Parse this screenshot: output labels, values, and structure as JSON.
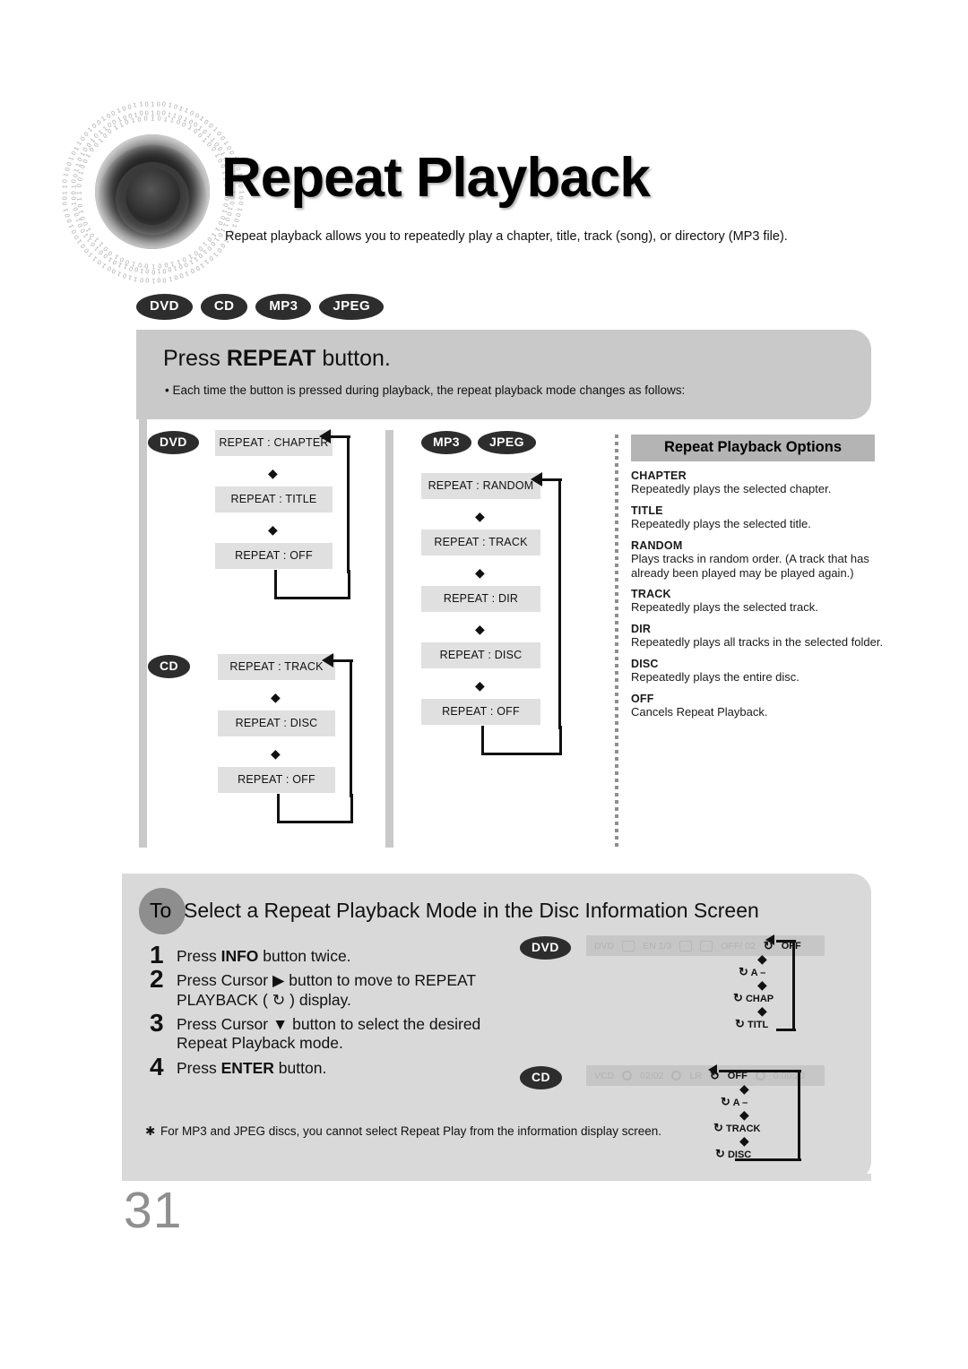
{
  "header": {
    "title": "Repeat Playback",
    "intro": "Repeat playback allows you to repeatedly play a chapter, title, track (song), or directory (MP3 file).",
    "disc_badges": [
      "DVD",
      "CD",
      "MP3",
      "JPEG"
    ]
  },
  "press_panel": {
    "title_pre": "Press ",
    "title_bold": "REPEAT",
    "title_post": " button.",
    "bullet": "• Each time the button is pressed during playback, the repeat playback mode changes as follows:"
  },
  "flows": [
    {
      "badge": "DVD",
      "steps": [
        "REPEAT : CHAPTER",
        "REPEAT : TITLE",
        "REPEAT : OFF"
      ]
    },
    {
      "badge": "CD",
      "steps": [
        "REPEAT : TRACK",
        "REPEAT : DISC",
        "REPEAT : OFF"
      ]
    },
    {
      "badges": [
        "MP3",
        "JPEG"
      ],
      "steps": [
        "REPEAT : RANDOM",
        "REPEAT : TRACK",
        "REPEAT : DIR",
        "REPEAT : DISC",
        "REPEAT : OFF"
      ]
    }
  ],
  "options": {
    "header": "Repeat Playback Options",
    "items": [
      {
        "term": "CHAPTER",
        "desc": "Repeatedly plays the selected chapter."
      },
      {
        "term": "TITLE",
        "desc": "Repeatedly plays the selected title."
      },
      {
        "term": "RANDOM",
        "desc": "Plays tracks in random order.\n(A track that has already been played may be played again.)"
      },
      {
        "term": "TRACK",
        "desc": "Repeatedly plays the selected track."
      },
      {
        "term": "DIR",
        "desc": "Repeatedly plays all tracks in the selected folder."
      },
      {
        "term": "DISC",
        "desc": "Repeatedly plays the entire disc."
      },
      {
        "term": "OFF",
        "desc": "Cancels Repeat Playback."
      }
    ]
  },
  "bottom": {
    "to_chip": "To",
    "heading": "Select a Repeat Playback Mode in the Disc Information Screen",
    "steps": [
      {
        "num": "1",
        "text": "Press INFO button twice.",
        "pre": "Press ",
        "bold": "INFO",
        "post": " button twice."
      },
      {
        "num": "2",
        "pre": "Press Cursor ▶ button to move to REPEAT PLAYBACK ( ↻ ) display.",
        "bold": "",
        "post": ""
      },
      {
        "num": "3",
        "pre": "Press Cursor ▼ button to select the desired Repeat Playback mode.",
        "bold": "",
        "post": ""
      },
      {
        "num": "4",
        "pre": "Press ",
        "bold": "ENTER",
        "post": " button."
      }
    ],
    "note_star": "✱",
    "note": "For MP3 and JPEG discs, you cannot select Repeat Play from the information display screen."
  },
  "osd": [
    {
      "badge": "DVD",
      "bar_items": [
        "DVD",
        "EN 1/3",
        "OFF/ 02"
      ],
      "bar_repeat": "OFF",
      "cascade": [
        "A –",
        "CHAP",
        "TITL"
      ]
    },
    {
      "badge": "CD",
      "bar_items": [
        "VCD",
        "02/02",
        "LR"
      ],
      "bar_repeat": "OFF",
      "bar_time": "0:00:20",
      "cascade": [
        "A –",
        "TRACK",
        "DISC"
      ]
    }
  ],
  "folio": "31"
}
